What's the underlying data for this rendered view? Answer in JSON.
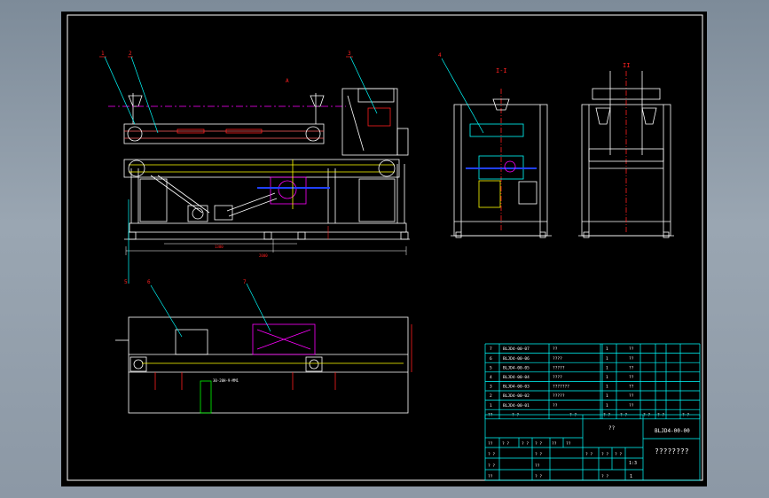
{
  "drawing": {
    "section_label_top": "I-I",
    "section_label_right": "II",
    "view_arrow_label": "A",
    "balloons": [
      "1",
      "2",
      "3",
      "4",
      "5",
      "6",
      "7"
    ],
    "dim_overall": "2000",
    "dim_lower": "1380",
    "plan_caption": "30-20H-9-MM1"
  },
  "bom": {
    "rows": [
      {
        "no": "7",
        "code": "BLJD4-00-07",
        "name": "??",
        "qty": "1",
        "mat": "??"
      },
      {
        "no": "6",
        "code": "BLJD4-00-06",
        "name": "????",
        "qty": "1",
        "mat": "??"
      },
      {
        "no": "5",
        "code": "BLJD4-00-05",
        "name": "?????",
        "qty": "1",
        "mat": "??"
      },
      {
        "no": "4",
        "code": "BLJD4-00-04",
        "name": "????",
        "qty": "1",
        "mat": "??"
      },
      {
        "no": "3",
        "code": "BLJD4-00-03",
        "name": "???????",
        "qty": "1",
        "mat": "??"
      },
      {
        "no": "2",
        "code": "BLJD4-00-02",
        "name": "?????",
        "qty": "1",
        "mat": "??"
      },
      {
        "no": "1",
        "code": "BLJD4-00-01",
        "name": "??",
        "qty": "1",
        "mat": "??"
      }
    ],
    "header": {
      "no": "??",
      "code": "? ?",
      "name": "? ?",
      "qty": "? ?",
      "mat": "? ?",
      "w1": "? ?",
      "w2": "? ?",
      "note": "? ?"
    }
  },
  "title_block": {
    "drawing_no": "BLJD4-00-00",
    "drawing_name": "????????",
    "mark_1": "??",
    "scale": "1:3",
    "sheet": "1",
    "cells": [
      "??",
      "? ?",
      "? ?",
      "? ?",
      "??",
      "??",
      "? ?",
      "? ?",
      "? ?",
      "??",
      "??",
      "? ?",
      "? ?",
      "? ?",
      "? ?",
      "? ?"
    ]
  },
  "colors": {
    "background_outer": "#8c98a5",
    "sheet": "#000000",
    "line": "#ffffff",
    "table": "#00ffff",
    "accent_magenta": "#ff00ff",
    "accent_yellow": "#ffff00",
    "accent_red": "#ff2020",
    "accent_blue": "#2040ff",
    "accent_green": "#00ff00"
  }
}
